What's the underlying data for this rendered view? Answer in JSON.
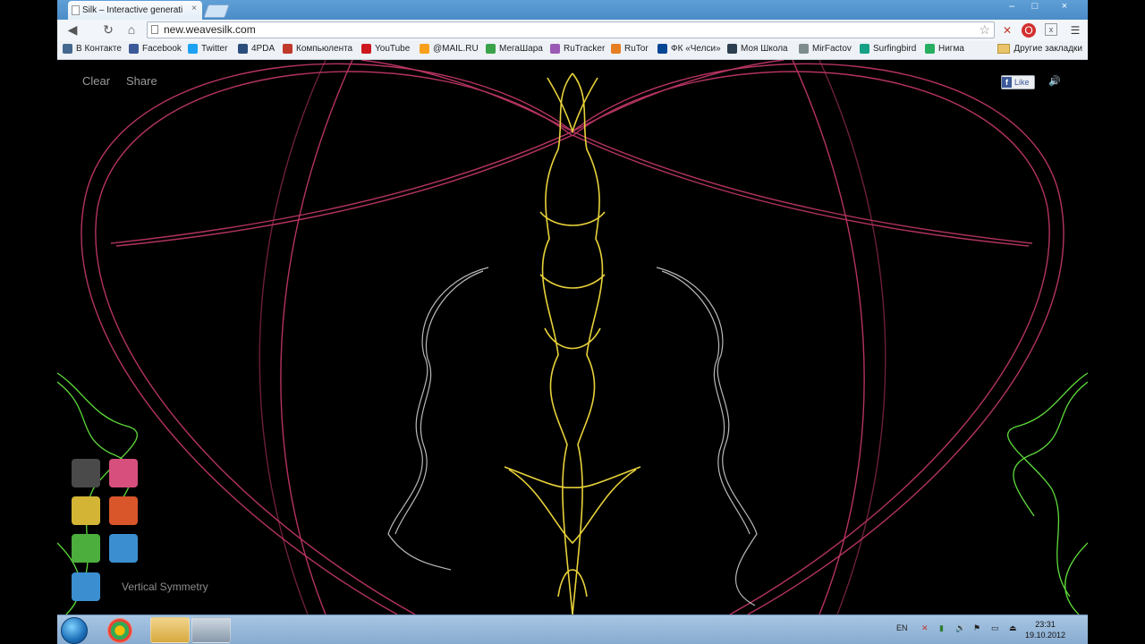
{
  "browser": {
    "tab_title": "Silk – Interactive generati",
    "url": "new.weavesilk.com",
    "bookmarks": [
      {
        "label": "В Контакте",
        "color": "#45688e"
      },
      {
        "label": "Facebook",
        "color": "#3b5998"
      },
      {
        "label": "Twitter",
        "color": "#1da1f2"
      },
      {
        "label": "4PDA",
        "color": "#2b4d7c"
      },
      {
        "label": "Компьюлента",
        "color": "#c0392b"
      },
      {
        "label": "YouTube",
        "color": "#cc181e"
      },
      {
        "label": "@MAIL.RU",
        "color": "#f89f1b"
      },
      {
        "label": "МегаШара",
        "color": "#3aa34a"
      },
      {
        "label": "RuTracker",
        "color": "#9b59b6"
      },
      {
        "label": "RuTor",
        "color": "#e67e22"
      },
      {
        "label": "ФК «Челси»",
        "color": "#034694"
      },
      {
        "label": "Моя Школа",
        "color": "#2c3e50"
      },
      {
        "label": "MirFactov",
        "color": "#7f8c8d"
      },
      {
        "label": "Surfingbird",
        "color": "#16a085"
      },
      {
        "label": "Нигма",
        "color": "#27ae60"
      }
    ],
    "other_bookmarks": "Другие закладки"
  },
  "silk": {
    "clear_label": "Clear",
    "share_label": "Share",
    "like_label": "Like",
    "symmetry_label": "Vertical Symmetry",
    "swatches": [
      "#4a4a4a",
      "#d64f7d",
      "#d3b435",
      "#d9552a",
      "#4cae3c",
      "#3b8fd0",
      "#3b8fd0"
    ]
  },
  "taskbar": {
    "lang": "EN",
    "time": "23:31",
    "date": "19.10.2012"
  }
}
